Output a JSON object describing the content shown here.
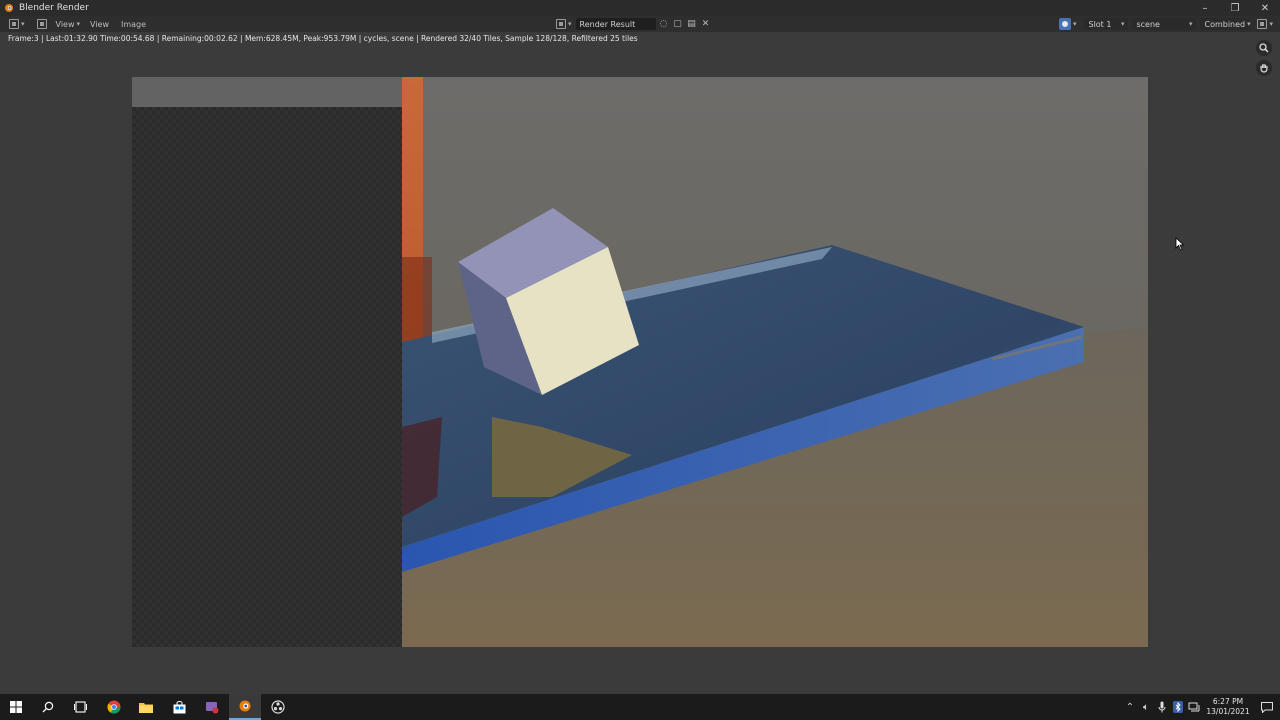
{
  "window": {
    "title": "Blender Render",
    "minimize_glyph": "–",
    "maximize_glyph": "❐",
    "close_glyph": "✕"
  },
  "header": {
    "menus": [
      "View",
      "Image"
    ],
    "image_name": "Render Result",
    "slot": "Slot 1",
    "view_layer": "scene",
    "pass": "Combined"
  },
  "stats": "Frame:3 | Last:01:32.90 Time:00:54.68 | Remaining:00:02.62 | Mem:628.45M, Peak:953.79M | cycles, scene | Rendered 32/40 Tiles, Sample 128/128, Refiltered 25 tiles",
  "icons": {
    "zoom": "zoom-icon",
    "pan": "hand-pan-icon"
  },
  "taskbar": {
    "apps": [
      "start",
      "search",
      "task-view",
      "chrome",
      "file-explorer",
      "store",
      "snipping-tool",
      "blender",
      "obs"
    ],
    "time": "6:27 PM",
    "date": "13/01/2021"
  },
  "colors": {
    "accent": "#4772b3",
    "render_orange": "#c4632f",
    "tray_blue": "#3a5fa8"
  }
}
